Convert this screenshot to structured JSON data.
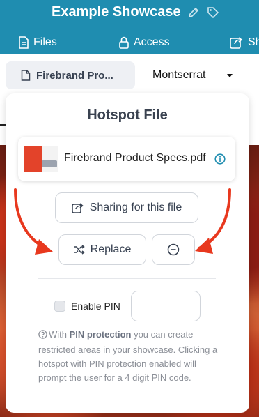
{
  "header": {
    "title": "Example Showcase",
    "tabs": [
      {
        "label": "Files",
        "icon": "file-icon"
      },
      {
        "label": "Access",
        "icon": "lock-icon"
      },
      {
        "label": "Sh",
        "icon": "share-icon"
      }
    ]
  },
  "subbar": {
    "file_chip": "Firebrand Pro...",
    "font_select": "Montserrat"
  },
  "popover": {
    "title": "Hotspot File",
    "file_name": "Firebrand Product Specs.pdf",
    "share_label": "Sharing for this file",
    "replace_label": "Replace",
    "pin_label": "Enable PIN",
    "help_pre": "With ",
    "help_bold": "PIN protection",
    "help_post": " you can create restricted areas in your showcase. Clicking a hotspot with PIN protection enabled will prompt the user for a 4 digit PIN code."
  },
  "colors": {
    "header_bg": "#1f8db0",
    "annotation_arrow": "#e8381e"
  }
}
